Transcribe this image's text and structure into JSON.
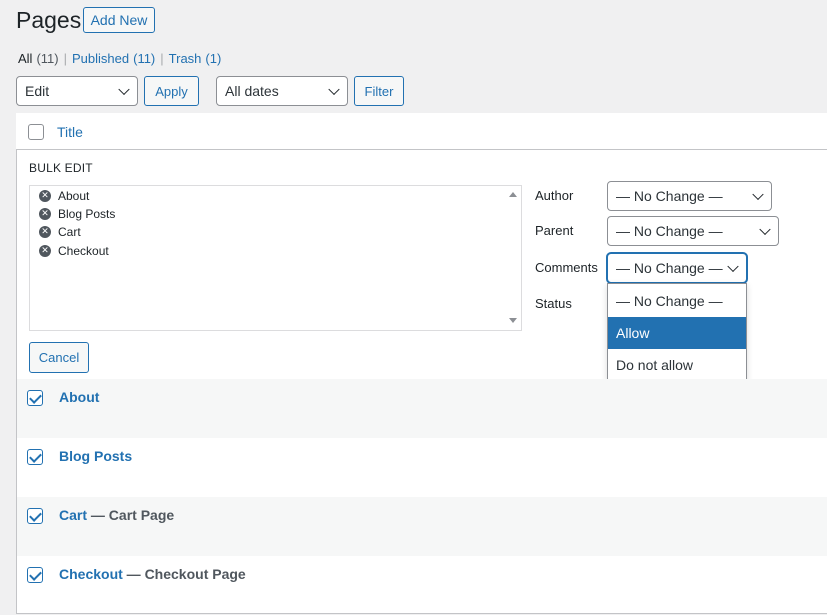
{
  "header": {
    "title": "Pages",
    "add_new": "Add New"
  },
  "filters": {
    "all": "All",
    "all_count": "(11)",
    "published": "Published",
    "published_count": "(11)",
    "trash": "Trash",
    "trash_count": "(1)",
    "sep": "|"
  },
  "toolbar": {
    "bulk_action": "Edit",
    "apply": "Apply",
    "dates": "All dates",
    "filter": "Filter"
  },
  "table": {
    "column_title": "Title"
  },
  "bulk_edit": {
    "title": "BULK EDIT",
    "items": [
      "About",
      "Blog Posts",
      "Cart",
      "Checkout"
    ],
    "cancel": "Cancel",
    "author_label": "Author",
    "author_value": "— No Change —",
    "parent_label": "Parent",
    "parent_value": "— No Change —",
    "comments_label": "Comments",
    "comments_value": "— No Change —",
    "status_label": "Status",
    "comments_options": [
      "— No Change —",
      "Allow",
      "Do not allow"
    ],
    "comments_highlighted": "Allow"
  },
  "rows": [
    {
      "title": "About",
      "state": "",
      "checked": true
    },
    {
      "title": "Blog Posts",
      "state": "",
      "checked": true
    },
    {
      "title": "Cart",
      "state": " — Cart Page",
      "checked": true
    },
    {
      "title": "Checkout",
      "state": " — Checkout Page",
      "checked": true
    }
  ],
  "colors": {
    "accent": "#2271b1",
    "text": "#1d2327",
    "background": "#f0f0f1"
  }
}
